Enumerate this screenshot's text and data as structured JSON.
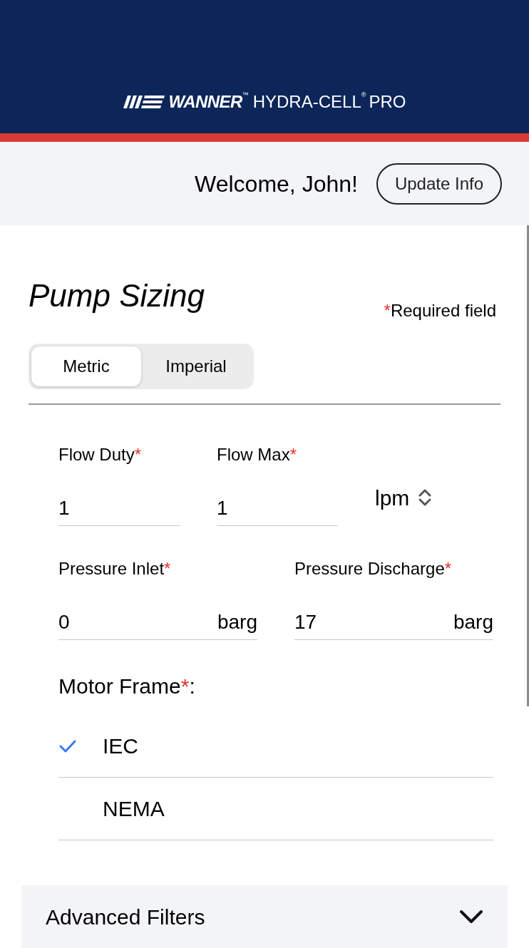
{
  "header": {
    "logo": {
      "brand": "WANNER",
      "brand_mark": "™",
      "product": "HYDRA-CELL",
      "product_mark": "®",
      "suffix": "PRO"
    }
  },
  "welcome": {
    "text": "Welcome, John!",
    "button": "Update Info"
  },
  "title": "Pump Sizing",
  "asterisk": "*",
  "required_note": "Required field",
  "unit_tabs": [
    {
      "label": "Metric",
      "selected": true
    },
    {
      "label": "Imperial",
      "selected": false
    }
  ],
  "flow": {
    "fields": [
      {
        "label": "Flow Duty",
        "required": true,
        "value": "1"
      },
      {
        "label": "Flow Max",
        "required": true,
        "value": "1"
      }
    ],
    "unit": "lpm"
  },
  "pressure": [
    {
      "label": "Pressure Inlet",
      "required": true,
      "value": "0",
      "unit": "barg"
    },
    {
      "label": "Pressure Discharge",
      "required": true,
      "value": "17",
      "unit": "barg"
    }
  ],
  "motor_frame": {
    "label": "Motor Frame",
    "required": true,
    "suffix": ":",
    "options": [
      {
        "label": "IEC",
        "selected": true
      },
      {
        "label": "NEMA",
        "selected": false
      }
    ]
  },
  "advanced_filters": {
    "label": "Advanced Filters",
    "expanded": false
  }
}
